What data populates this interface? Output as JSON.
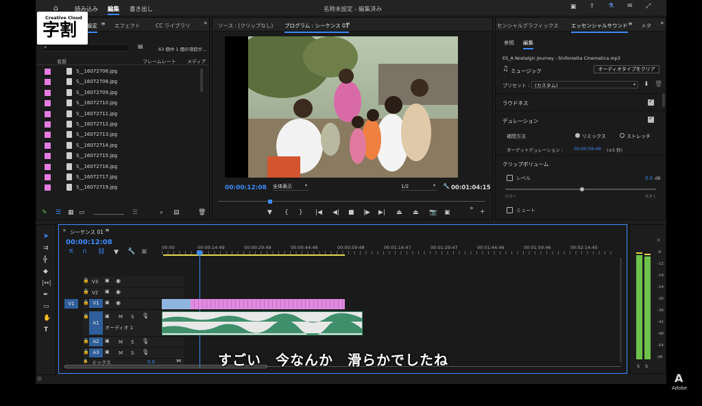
{
  "topbar": {
    "nav_import": "読み込み",
    "nav_edit": "編集",
    "nav_export": "書き出し",
    "project_title": "名称未設定 - 編集済み"
  },
  "badge": {
    "line1": "Creative Cloud",
    "line2": "字割"
  },
  "project_panel": {
    "tab_settings": "設定",
    "tab_effects": "エフェクト",
    "tab_cc_library": "CC ライブラリ",
    "item_count": "63 個中 1 個の項目が...",
    "col_name": "名前",
    "col_framerate": "フレームレート",
    "col_media": "メディア",
    "files": [
      "S__16072706.jpg",
      "S__16072708.jpg",
      "S__16072709.jpg",
      "S__16072710.jpg",
      "S__16072711.jpg",
      "S__16072712.jpg",
      "S__16072713.jpg",
      "S__16072714.jpg",
      "S__16072715.jpg",
      "S__16072716.jpg",
      "S__16072717.jpg",
      "S__16072719.jpg"
    ]
  },
  "monitor": {
    "tab_source": "ソース : (クリップなし)",
    "tab_program": "プログラム : シーケンス 01",
    "current_time": "00:00:12:08",
    "zoom": "全体表示",
    "resolution": "1/2",
    "duration": "00:01:04:15"
  },
  "essential": {
    "tab_graphics": "センシャルグラフィックス",
    "tab_sound": "エッセンシャルサウンド",
    "tab_more": "メタ",
    "sub_browse": "参照",
    "sub_edit": "編集",
    "clip_name": "ES_A Nostalgic Journey - Sinfonietta Cinematica.mp3",
    "type": "ミュージック",
    "clear_btn": "オーディオタイプをクリア",
    "preset_label": "プリセット :",
    "preset_value": "(カスタム)",
    "loudness": "ラウドネス",
    "duration_section": "デュレーション",
    "method_label": "補間方法",
    "opt_remix": "リミックス",
    "opt_stretch": "ストレッチ",
    "target_label": "ターゲットデュレーション :",
    "target_value": "00:00:59:49",
    "target_range": "(±5 秒)",
    "clip_volume": "クリップボリューム",
    "level": "レベル",
    "level_value": "0.0",
    "level_unit": "dB",
    "min_label": "小さく",
    "max_label": "大きく",
    "mute": "ミュート"
  },
  "timeline": {
    "tab": "シーケンス 01",
    "timecode": "00:00:12:08",
    "ruler": [
      "00:00",
      "00:00:14:49",
      "00:00:29:49",
      "00:00:44:48",
      "00:00:59:48",
      "00:01:14:47",
      "00:01:29:47",
      "00:01:44:46",
      "00:01:59:46",
      "00:02:14:45"
    ],
    "tracks_video": [
      "V3",
      "V2",
      "V1"
    ],
    "source_patch_v": "V1",
    "tracks_audio": [
      "A1",
      "A2",
      "A3"
    ],
    "audio1_name": "オーディオ 1",
    "mix_label": "ミックス",
    "mix_value": "0.0",
    "m": "M",
    "s": "S"
  },
  "meter": {
    "scale": [
      "0",
      "-6",
      "-12",
      "-18",
      "-24",
      "-30",
      "-36",
      "-42",
      "-48",
      "-54",
      "dB"
    ],
    "solo_l": "S",
    "solo_r": "S"
  },
  "subtitle": "すごい　今なんか　滑らかでしたね",
  "adobe": "Adobe",
  "colors": {
    "accent": "#3d8cff",
    "clip_pink": "#e08be0",
    "clip_blue": "#8fb4e0",
    "audio_clip": "#3f8f6b",
    "yellow": "#e6d84a",
    "meter_green": "#6cc24a"
  }
}
